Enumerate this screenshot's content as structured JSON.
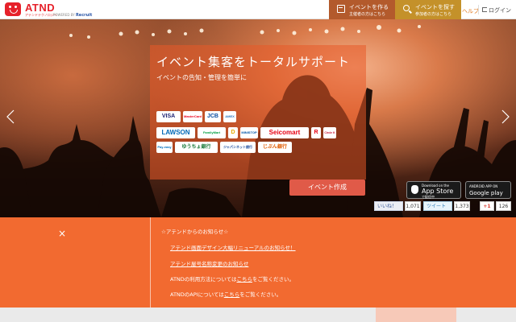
{
  "header": {
    "logo_text": "ATND",
    "logo_sub": "アテンドテクノロジー",
    "powered": "POWERED BY",
    "powered_brand": "Recruit",
    "create_btn": {
      "title": "イベントを作る",
      "sub": "主催者の方はこちら"
    },
    "find_btn": {
      "title": "イベントを探す",
      "sub": "参加者の方はこちら"
    },
    "help": "ヘルプ",
    "login": "ログイン"
  },
  "hero": {
    "title": "イベント集客をトータルサポート",
    "subtitle": "イベントの告知・管理を簡単に",
    "payments_row1": [
      "VISA",
      "MasterCard",
      "JCB",
      "AMEX"
    ],
    "payments_row2": [
      "LAWSON",
      "FamilyMart",
      "D",
      "MINISTOP",
      "Seicomart",
      "R",
      "Circle K"
    ],
    "payments_row3": [
      "Pay-easy",
      "ゆうちょ銀行",
      "ジャパンネット銀行",
      "じぶん銀行"
    ],
    "create_button": "イベント作成",
    "appstore": {
      "small": "Download on the",
      "big": "App Store",
      "note": "で配信中"
    },
    "gplay": {
      "small": "ANDROID APP ON",
      "big": "Google play"
    },
    "facebook": {
      "label": "いいね！",
      "count": "1,071"
    },
    "twitter": {
      "label": "ツイート",
      "count": "1,373"
    },
    "gplus": {
      "label": "+1",
      "count": "126"
    }
  },
  "notice": {
    "close": "×",
    "title": "☆アテンドからのお知らせ☆",
    "link1": "アテンド画面デザイン大幅リニューアルのお知らせ！",
    "link2": "アテンド屋号名称変更のお知らせ",
    "info1_pre": "ATNDの利用方法については",
    "info1_link": "こちら",
    "info1_post": "をご覧ください。",
    "info2_pre": "ATNDのAPIについては",
    "info2_link": "こちら",
    "info2_post": "をご覧ください。"
  },
  "colors": {
    "brand_red": "#e6212a",
    "header_create": "#b35a2c",
    "header_find": "#c4912a",
    "cta": "#e05a48",
    "notice_bg": "#f26a30"
  }
}
